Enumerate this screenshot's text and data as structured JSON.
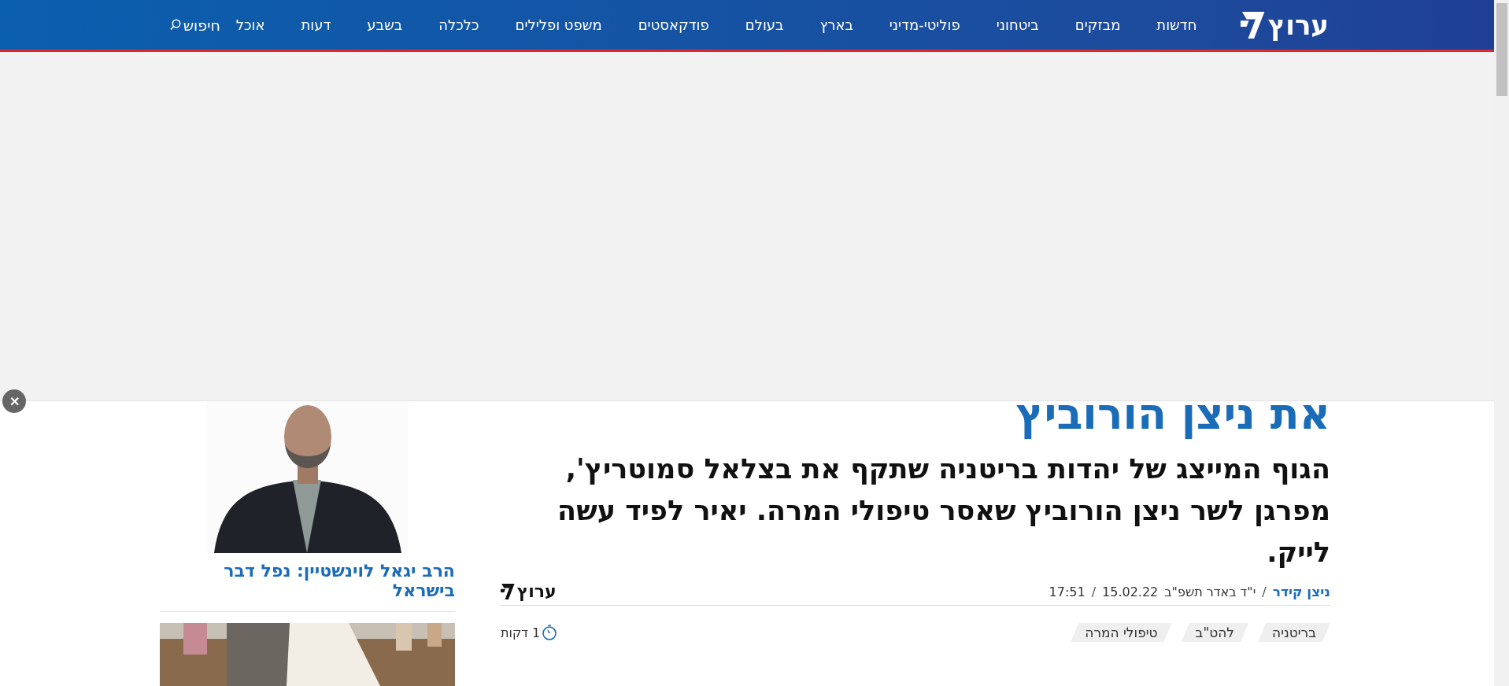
{
  "nav": {
    "logo": "ערוץ",
    "items": [
      {
        "label": "חדשות"
      },
      {
        "label": "מבזקים"
      },
      {
        "label": "ביטחוני"
      },
      {
        "label": "פוליטי-מדיני"
      },
      {
        "label": "בארץ"
      },
      {
        "label": "בעולם"
      },
      {
        "label": "פודקאסטים"
      },
      {
        "label": "משפט ופלילים"
      },
      {
        "label": "כלכלה"
      },
      {
        "label": "בשבע"
      },
      {
        "label": "דעות"
      },
      {
        "label": "אוכל"
      }
    ],
    "search": "חיפוש"
  },
  "ad": {
    "close": "✕"
  },
  "article": {
    "headline": "את ניצן הורוביץ",
    "subtitle": "הגוף המייצג של יהדות בריטניה שתקף את בצלאל סמוטריץ', מפרגן לשר ניצן הורוביץ שאסר טיפולי המרה. יאיר לפיד עשה לייק.",
    "author": "ניצן קידר",
    "separators": [
      "/",
      "/"
    ],
    "date": "י\"ד באדר תשפ\"ב",
    "date_greg": "15.02.22",
    "time": "17:51",
    "logo": "ערוץ",
    "tags": [
      "בריטניה",
      "להט\"ב",
      "טיפולי המרה"
    ],
    "read_time": "1 דקות"
  },
  "sidebar": {
    "items": [
      {
        "kind": "picture",
        "title": "הרב יגאל לוינשטיין: נפל דבר בישראל"
      },
      {
        "kind": "picture"
      }
    ]
  }
}
